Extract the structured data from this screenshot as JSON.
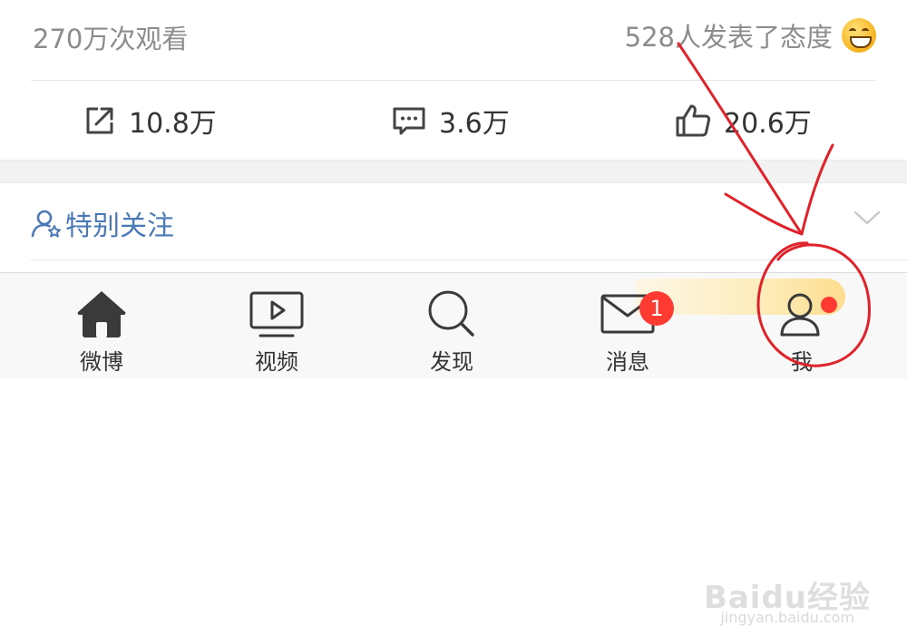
{
  "stats": {
    "views": "270万次观看",
    "attitudes": "528人发表了态度",
    "emoji_icon": "grinning-emoji"
  },
  "actions": {
    "share": {
      "icon": "share-icon",
      "count": "10.8万"
    },
    "comment": {
      "icon": "comment-icon",
      "count": "3.6万"
    },
    "like": {
      "icon": "thumbs-up-icon",
      "count": "20.6万"
    }
  },
  "special_follow": {
    "label": "特别关注",
    "icon": "user-star-icon",
    "chevron": "chevron-down-icon"
  },
  "tabbar": {
    "items": [
      {
        "label": "微博",
        "icon": "home-icon"
      },
      {
        "label": "视频",
        "icon": "video-icon"
      },
      {
        "label": "发现",
        "icon": "search-icon"
      },
      {
        "label": "消息",
        "icon": "mail-icon",
        "badge": "1"
      },
      {
        "label": "我",
        "icon": "user-icon",
        "dot": true
      }
    ]
  },
  "watermark": {
    "text": "Baidu经验",
    "sub": "jingyan.baidu.com"
  },
  "colors": {
    "accent_blue": "#4a79b8",
    "badge_red": "#ff3a30",
    "annotation_red": "#e0222a",
    "muted_text": "#8c8c8c"
  }
}
